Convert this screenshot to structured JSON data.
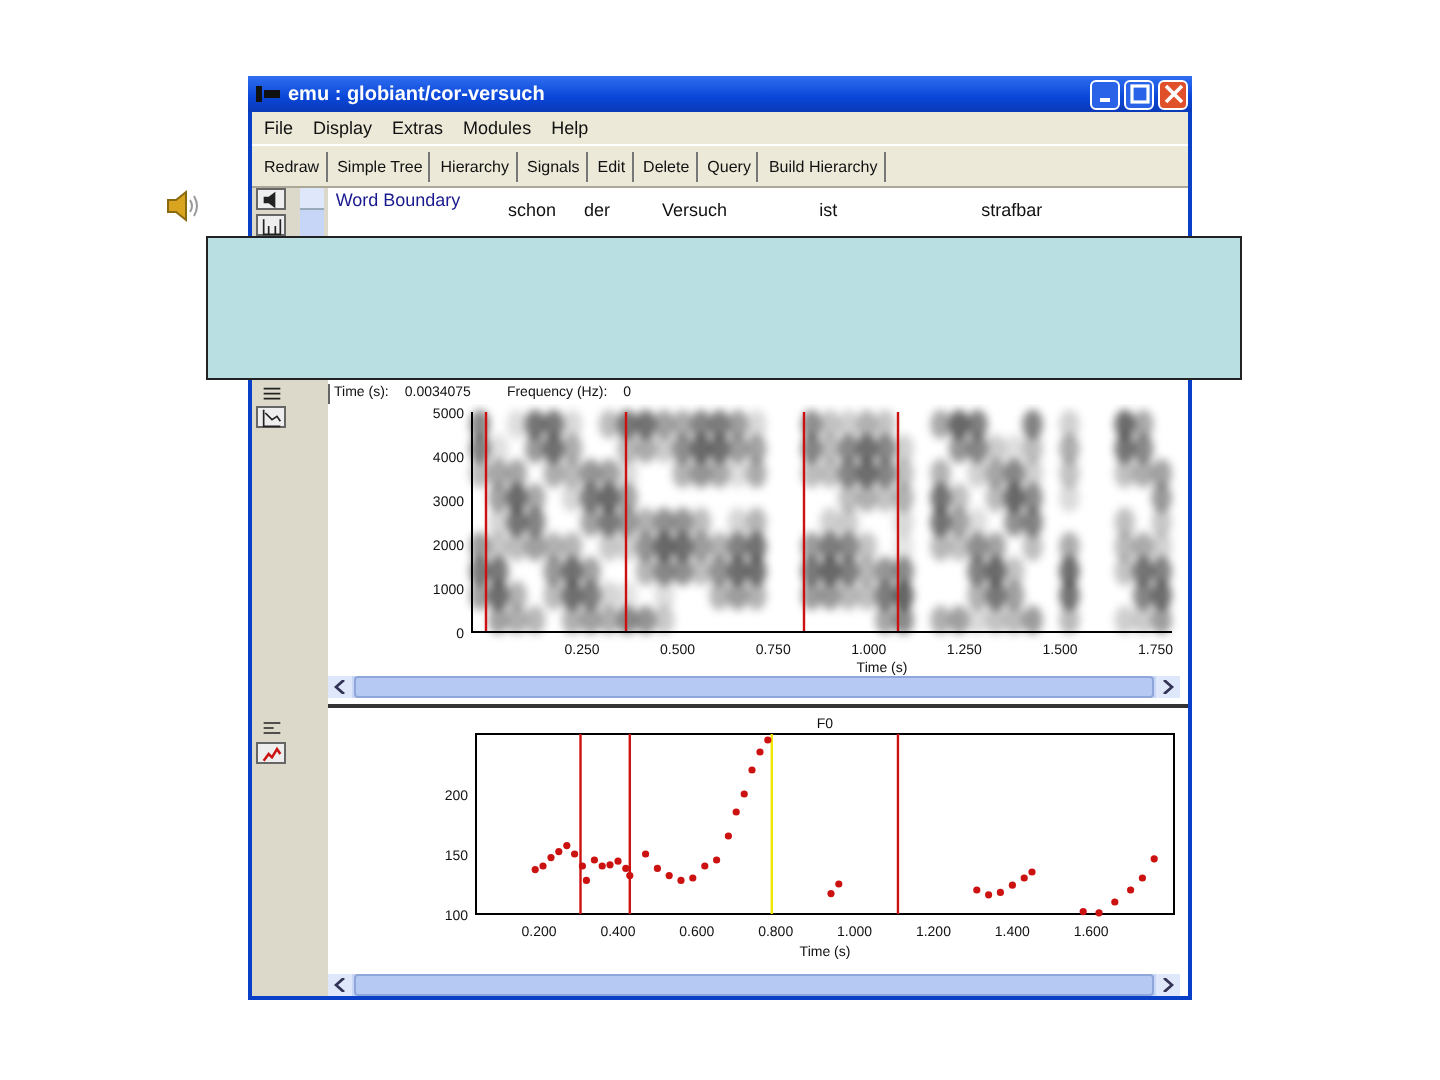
{
  "window": {
    "title": "emu : globiant/cor-versuch"
  },
  "menu": [
    "File",
    "Display",
    "Extras",
    "Modules",
    "Help"
  ],
  "toolbar": [
    "Redraw",
    "Simple Tree",
    "Hierarchy",
    "Signals",
    "Edit",
    "Delete",
    "Query",
    "Build Hierarchy"
  ],
  "tier": {
    "label": "Word Boundary",
    "words": [
      "schon",
      "der",
      "Versuch",
      "ist",
      "strafbar"
    ]
  },
  "readout": {
    "time_label": "Time (s):",
    "time": "0.0034075",
    "frequency_label": "Frequency (Hz):",
    "frequency": "0"
  },
  "spectrogram": {
    "yticks": [
      "5000",
      "4000",
      "3000",
      "2000",
      "1000",
      "0"
    ],
    "xticks": [
      "0.250",
      "0.500",
      "0.750",
      "1.000",
      "1.250",
      "1.500",
      "1.750"
    ],
    "xlabel": "Time (s)"
  },
  "f0_panel": {
    "chart_data": {
      "type": "scatter",
      "title": "F0",
      "xlabel": "Time (s)",
      "xlim": [
        0.04,
        1.81
      ],
      "ylim": [
        100,
        250
      ],
      "yticks": [
        100,
        150,
        200
      ],
      "xticks": [
        {
          "value": 0.2,
          "label": "0.200"
        },
        {
          "value": 0.4,
          "label": "0.400"
        },
        {
          "value": 0.6,
          "label": "0.600"
        },
        {
          "value": 0.8,
          "label": "0.800"
        },
        {
          "value": 1.0,
          "label": "1.000"
        },
        {
          "value": 1.2,
          "label": "1.200"
        },
        {
          "value": 1.4,
          "label": "1.400"
        },
        {
          "value": 1.6,
          "label": "1.600"
        }
      ],
      "series": [
        {
          "color": "#cc1111",
          "x": [
            0.19,
            0.21,
            0.23,
            0.25,
            0.27,
            0.29,
            0.31,
            0.32,
            0.34,
            0.36,
            0.38,
            0.4,
            0.42,
            0.43,
            0.47,
            0.5,
            0.53,
            0.56,
            0.59,
            0.62,
            0.65,
            0.68,
            0.7,
            0.72,
            0.74,
            0.76,
            0.78,
            0.94,
            0.96,
            1.31,
            1.34,
            1.37,
            1.4,
            1.43,
            1.45,
            1.58,
            1.62,
            1.66,
            1.7,
            1.73,
            1.76
          ],
          "values": [
            137,
            140,
            147,
            152,
            157,
            150,
            140,
            128,
            145,
            140,
            141,
            144,
            138,
            132,
            150,
            138,
            132,
            128,
            130,
            140,
            145,
            165,
            185,
            200,
            220,
            235,
            245,
            117,
            125,
            120,
            116,
            118,
            124,
            130,
            135,
            102,
            101,
            110,
            120,
            130,
            146
          ]
        }
      ],
      "ref_lines": [
        {
          "axis": "x",
          "value": 0.305,
          "color": "#cc1111"
        },
        {
          "axis": "x",
          "value": 0.43,
          "color": "#cc1111"
        },
        {
          "axis": "x",
          "value": 0.79,
          "color": "#f2e600"
        },
        {
          "axis": "x",
          "value": 1.11,
          "color": "#cc1111"
        }
      ]
    }
  }
}
